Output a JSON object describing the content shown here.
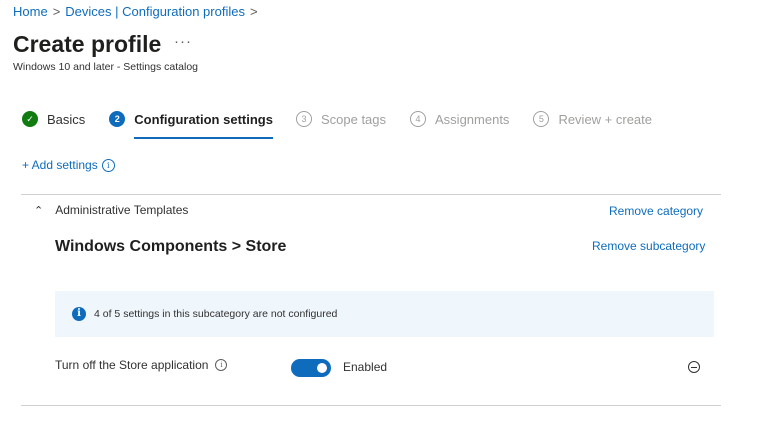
{
  "breadcrumb": {
    "home": "Home",
    "devices": "Devices | Configuration profiles",
    "separator": ">"
  },
  "page": {
    "title": "Create profile",
    "more": "···",
    "subtitle": "Windows 10 and later - Settings catalog"
  },
  "steps": [
    {
      "number": "✓",
      "label": "Basics",
      "state": "done"
    },
    {
      "number": "2",
      "label": "Configuration settings",
      "state": "active"
    },
    {
      "number": "3",
      "label": "Scope tags",
      "state": "todo"
    },
    {
      "number": "4",
      "label": "Assignments",
      "state": "todo"
    },
    {
      "number": "5",
      "label": "Review + create",
      "state": "todo"
    }
  ],
  "add_settings": {
    "label": "+ Add settings",
    "info": "i"
  },
  "category": {
    "name": "Administrative Templates",
    "remove_label": "Remove category",
    "subcategory": "Windows Components > Store",
    "remove_subcategory_label": "Remove subcategory"
  },
  "banner": {
    "icon": "i",
    "text": "4 of 5 settings in this subcategory are not configured"
  },
  "setting": {
    "name": "Turn off the Store application",
    "info": "i",
    "toggle_on": true,
    "state_label": "Enabled"
  },
  "colors": {
    "accent": "#0f6cbd",
    "success": "#107c10",
    "banner_bg": "#eff6fc"
  }
}
